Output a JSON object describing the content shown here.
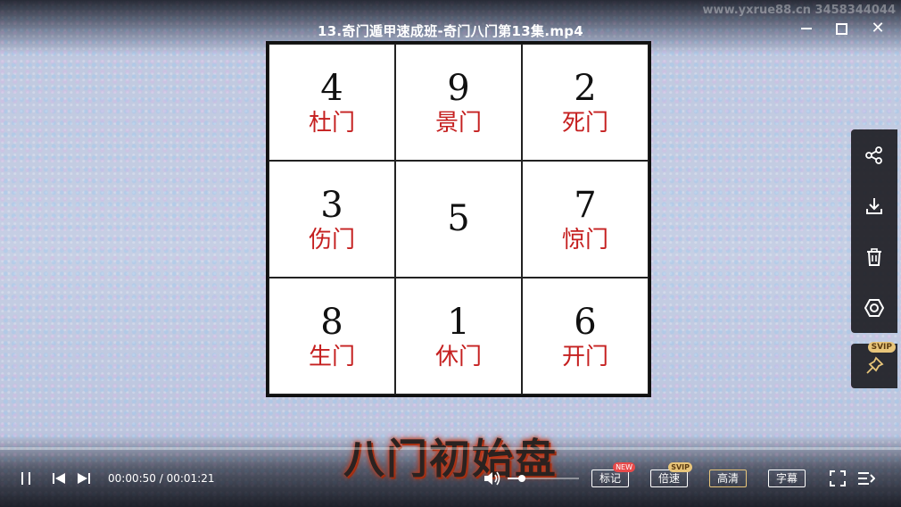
{
  "window": {
    "title": "13.奇门遁甲速成班-奇门八门第13集.mp4",
    "watermark": "www.yxrue88.cn  3458344044"
  },
  "grid": {
    "cells": [
      {
        "number": "4",
        "door": "杜门"
      },
      {
        "number": "9",
        "door": "景门"
      },
      {
        "number": "2",
        "door": "死门"
      },
      {
        "number": "3",
        "door": "伤门"
      },
      {
        "number": "5",
        "door": ""
      },
      {
        "number": "7",
        "door": "惊门"
      },
      {
        "number": "8",
        "door": "生门"
      },
      {
        "number": "1",
        "door": "休门"
      },
      {
        "number": "6",
        "door": "开门"
      }
    ]
  },
  "caption": "八门初始盘",
  "player": {
    "current_time": "00:00:50",
    "total_time": "00:01:21",
    "time_text": "00:00:50 / 00:01:21",
    "progress": 0.0,
    "volume": 0.2,
    "mark_label": "标记",
    "mark_badge": "NEW",
    "speed_label": "倍速",
    "speed_badge": "SVIP",
    "quality_label": "高清",
    "subtitle_label": "字幕"
  },
  "side_panel": {
    "icons": [
      "share-icon",
      "download-icon",
      "delete-icon",
      "view-icon"
    ],
    "pin_badge": "SVIP"
  },
  "colors": {
    "progress": "#3ca0f0",
    "door_text": "#c52020",
    "svip": "#e8c57a",
    "new_badge": "#e84a4a"
  }
}
